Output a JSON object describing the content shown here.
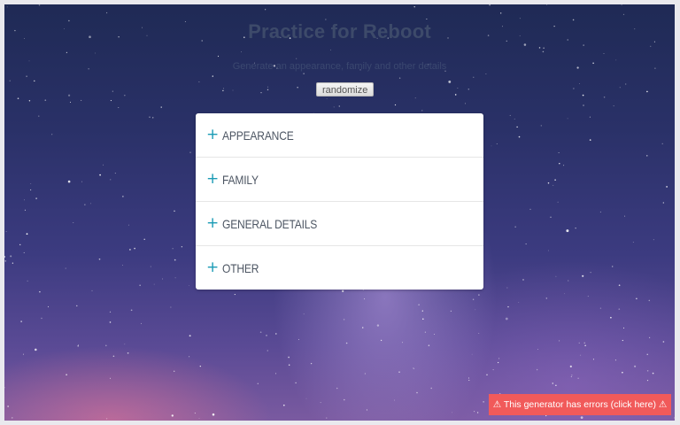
{
  "header": {
    "title": "Practice for Reboot",
    "subtitle": "Generate an appearance, family and other details"
  },
  "controls": {
    "randomize_label": "randomize"
  },
  "sections": [
    {
      "label": "APPEARANCE",
      "icon": "plus-icon"
    },
    {
      "label": "FAMILY",
      "icon": "plus-icon"
    },
    {
      "label": "GENERAL DETAILS",
      "icon": "plus-icon"
    },
    {
      "label": "OTHER",
      "icon": "plus-icon"
    }
  ],
  "error_banner": {
    "text": "⚠ This generator has errors (click here) ⚠"
  },
  "colors": {
    "accent": "#1a9bb5",
    "error": "#f15a5a",
    "panel": "#ffffff"
  }
}
